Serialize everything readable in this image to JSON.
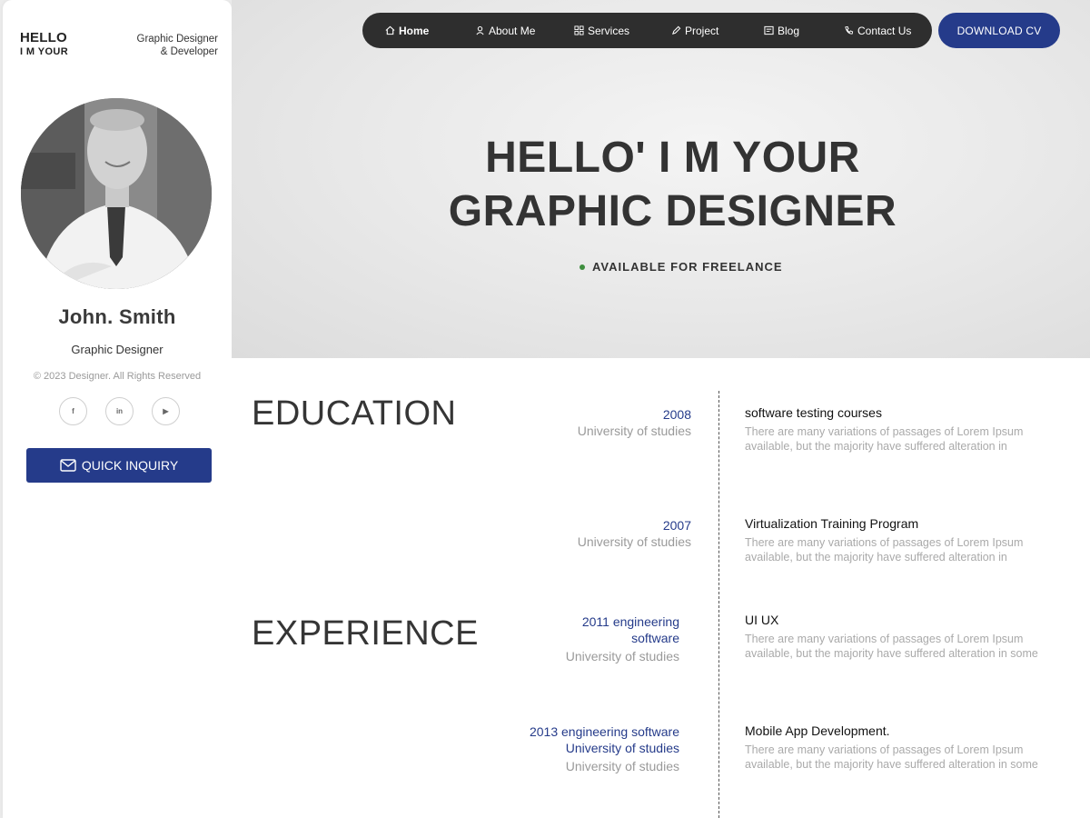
{
  "sidebar": {
    "brand_line1": "HELLO",
    "brand_line2": "I M YOUR",
    "tagline_line1": "Graphic Designer",
    "tagline_line2": "& Developer",
    "name": "John. Smith",
    "role": "Graphic Designer",
    "copyright": "© 2023 Designer. All Rights Reserved",
    "socials": [
      {
        "label": "f",
        "icon": "facebook-icon"
      },
      {
        "label": "in",
        "icon": "linkedin-icon"
      },
      {
        "label": "▶",
        "icon": "youtube-icon"
      }
    ],
    "inquiry_label": "QUICK INQUIRY"
  },
  "nav": {
    "items": [
      {
        "label": "Home",
        "icon": "home-icon",
        "active": true
      },
      {
        "label": "About Me",
        "icon": "user-icon"
      },
      {
        "label": "Services",
        "icon": "grid-icon"
      },
      {
        "label": "Project",
        "icon": "pen-icon"
      },
      {
        "label": "Blog",
        "icon": "blog-icon"
      },
      {
        "label": "Contact Us",
        "icon": "phone-icon"
      }
    ],
    "cv_label": "DOWNLOAD CV"
  },
  "hero": {
    "title_line1": "HELLO' I M YOUR",
    "title_line2": "GRAPHIC DESIGNER",
    "status": "AVAILABLE FOR FREELANCE"
  },
  "education": {
    "title": "EDUCATION",
    "entries": [
      {
        "year": "2008",
        "school": "University of studies",
        "course": "software testing courses",
        "desc_line1": "There are many variations of passages of Lorem Ipsum",
        "desc_line2": "available, but the majority have suffered alteration in"
      },
      {
        "year": "2007",
        "school": "University of studies",
        "course": "Virtualization Training Program",
        "desc_line1": "There are many variations of passages of Lorem Ipsum",
        "desc_line2": "available, but the majority have suffered alteration in"
      }
    ]
  },
  "experience": {
    "title": "EXPERIENCE",
    "entries": [
      {
        "year_line1": "2011 engineering",
        "year_line2": "software",
        "school": "University of studies",
        "course": "UI UX",
        "desc_line1": "There are many variations of passages of Lorem Ipsum",
        "desc_line2": "available, but the majority have suffered alteration in some"
      },
      {
        "year_line1": "2013 engineering software",
        "year_line2": "University of studies",
        "school": "University of studies",
        "course": "Mobile App Development.",
        "desc_line1": "There are many variations of passages of Lorem Ipsum",
        "desc_line2": "available, but the majority have suffered alteration in some"
      }
    ]
  },
  "colors": {
    "accent": "#253b8a",
    "status_dot": "#3e8e3e",
    "nav_bg": "#2e2e2e"
  }
}
